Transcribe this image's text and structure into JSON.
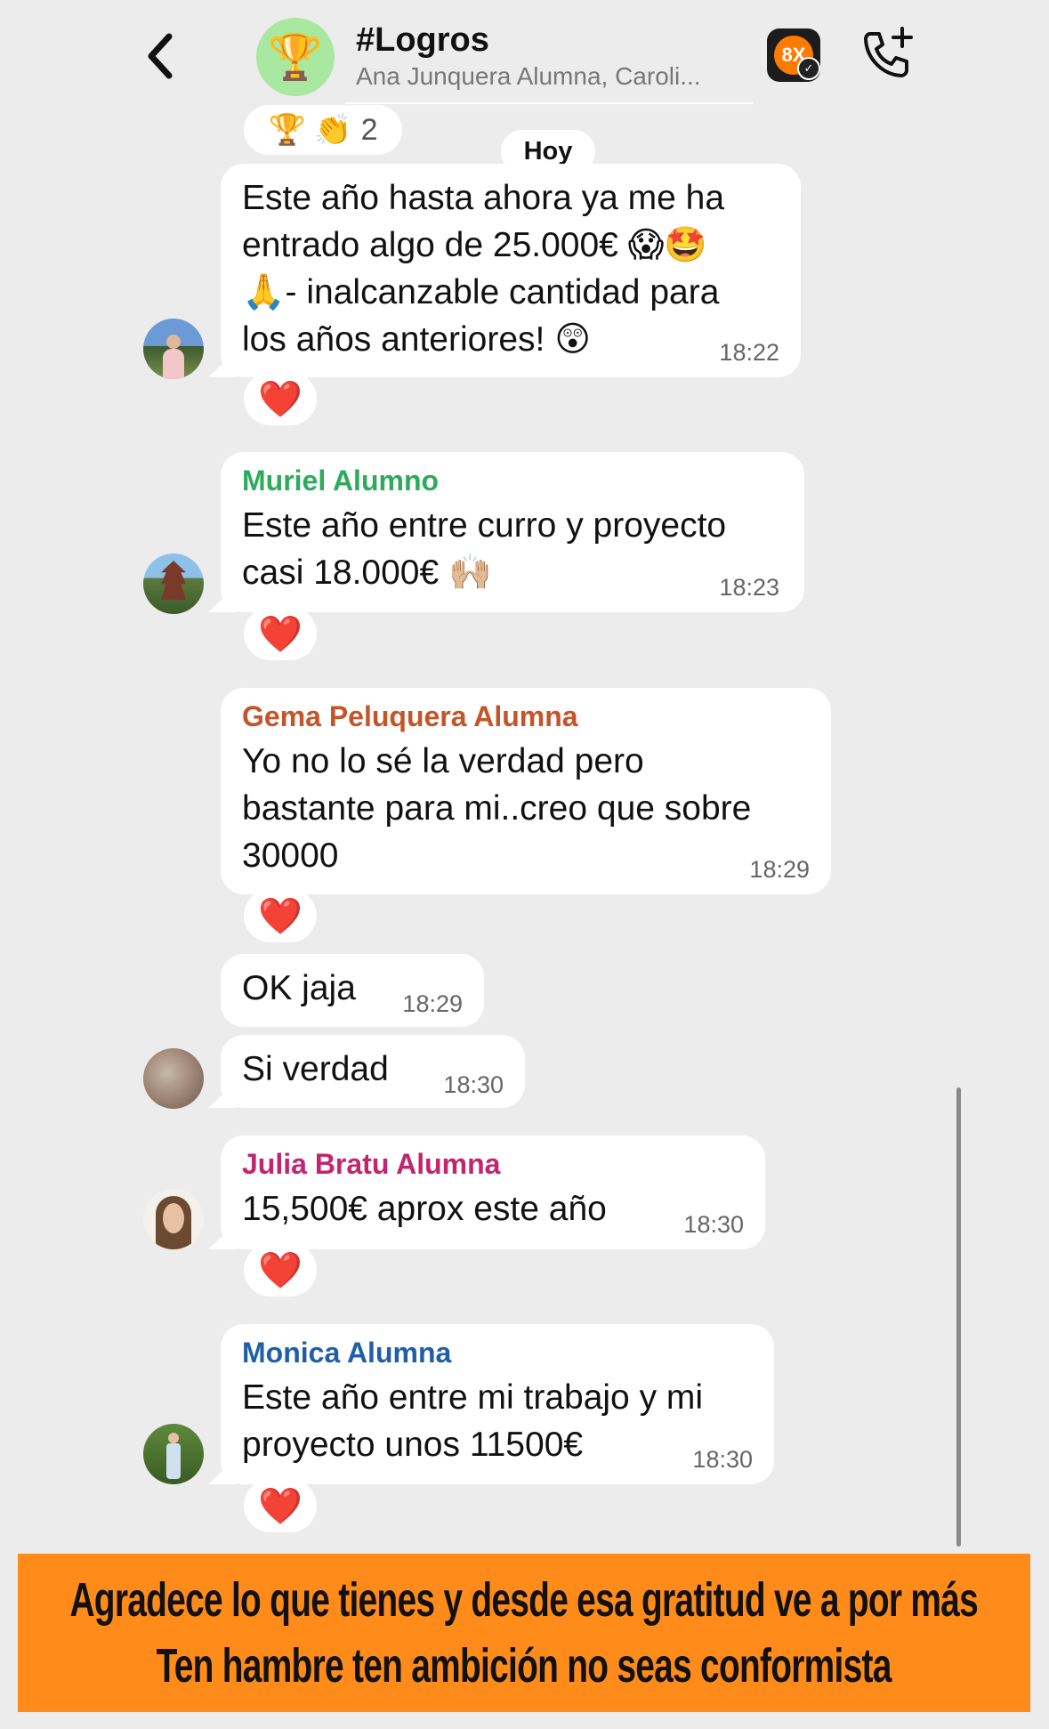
{
  "header": {
    "title": "#Logros",
    "participants": "Ana Junquera Alumna, Caroli...",
    "group_icon": "trophy-icon",
    "badge_label": "8X"
  },
  "top_reaction": {
    "emojis": "🏆 👏",
    "count": "2"
  },
  "date_divider": "Hoy",
  "messages": [
    {
      "sender": "",
      "lines": [
        "Este año hasta ahora ya me ha",
        "entrado algo de 25.000€ 😱🤩",
        "🙏- inalcanzable cantidad para",
        "los años anteriores! 😲"
      ],
      "time": "18:22",
      "reaction": "❤️"
    },
    {
      "sender": "Muriel Alumno",
      "sender_color": "#2eaa5c",
      "lines": [
        "Este año entre curro y proyecto",
        "casi 18.000€ 🙌🏼"
      ],
      "time": "18:23",
      "reaction": "❤️"
    },
    {
      "sender": "Gema Peluquera Alumna",
      "sender_color": "#c4552a",
      "lines": [
        "Yo no lo sé la verdad pero",
        "bastante para mi..creo que sobre",
        "30000"
      ],
      "time": "18:29",
      "reaction": "❤️"
    },
    {
      "sender": "",
      "lines": [
        "OK jaja"
      ],
      "time": "18:29"
    },
    {
      "sender": "",
      "lines": [
        "Si verdad"
      ],
      "time": "18:30"
    },
    {
      "sender": "Julia Bratu Alumna",
      "sender_color": "#c2256e",
      "lines": [
        "15,500€ aprox este año"
      ],
      "time": "18:30",
      "reaction": "❤️"
    },
    {
      "sender": "Monica Alumna",
      "sender_color": "#1f5fa8",
      "lines": [
        "Este año entre mi trabajo y mi",
        "proyecto unos 11500€"
      ],
      "time": "18:30",
      "reaction": "❤️"
    }
  ],
  "banner": {
    "line1": "Agradece lo que tienes y desde esa gratitud ve a por más",
    "line2": "Ten hambre ten ambición no seas conformista",
    "color": "#ff8c1a"
  }
}
